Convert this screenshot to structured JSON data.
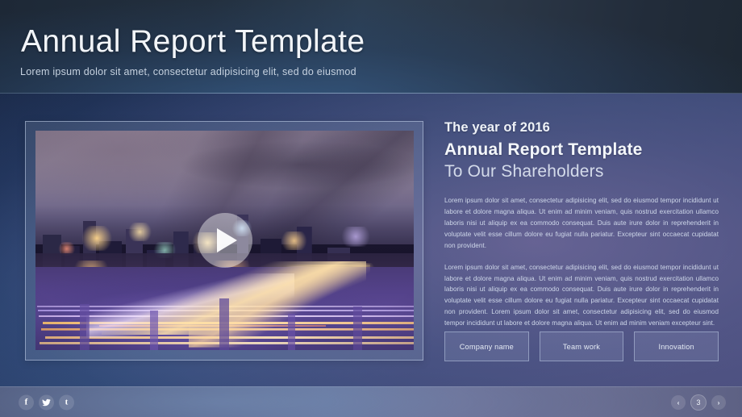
{
  "header": {
    "title": "Annual Report Template",
    "subtitle": "Lorem ipsum dolor sit amet, consectetur adipisicing elit, sed do eiusmod"
  },
  "media": {
    "play_label": "play-button",
    "image_description": "Night aerial view of a city skyline with illuminated elevated highway interchange and light trails"
  },
  "content": {
    "eyebrow": "The year of 2016",
    "headline": "Annual Report Template",
    "subhead": "To Our Shareholders",
    "paragraphs": [
      "Lorem ipsum dolor sit amet, consectetur adipisicing elit, sed do eiusmod tempor incididunt ut labore et dolore magna aliqua. Ut enim ad minim veniam, quis nostrud exercitation ullamco laboris nisi ut aliquip ex ea commodo consequat. Duis aute irure dolor in reprehenderit in voluptate velit esse cillum dolore eu fugiat nulla pariatur. Excepteur sint occaecat cupidatat non provident.",
      "Lorem ipsum dolor sit amet, consectetur adipisicing elit, sed do eiusmod tempor incididunt ut labore et dolore magna aliqua. Ut enim ad minim veniam, quis nostrud exercitation ullamco laboris nisi ut aliquip ex ea commodo consequat. Duis aute irure dolor in reprehenderit in voluptate velit esse cillum dolore eu fugiat nulla pariatur. Excepteur sint occaecat cupidatat non provident. Lorem ipsum dolor sit amet, consectetur adipisicing elit, sed do eiusmod tempor incididunt ut labore et dolore magna aliqua. Ut enim ad minim veniam excepteur sint."
    ],
    "buttons": [
      {
        "label": "Company name"
      },
      {
        "label": "Team work"
      },
      {
        "label": "Innovation"
      }
    ]
  },
  "footer": {
    "social": [
      {
        "name": "facebook-icon",
        "glyph": "f"
      },
      {
        "name": "twitter-icon",
        "glyph": ""
      },
      {
        "name": "tumblr-icon",
        "glyph": "t"
      }
    ],
    "pager": {
      "prev": "‹",
      "current": "3",
      "next": "›"
    }
  },
  "colors": {
    "header_bg": "#253242",
    "body_bg": "#3c4a78",
    "footer_bg": "#6a7ba2",
    "text_primary": "#f2f5f9",
    "text_muted": "#cfd8ea",
    "border": "#c6d6ec"
  }
}
